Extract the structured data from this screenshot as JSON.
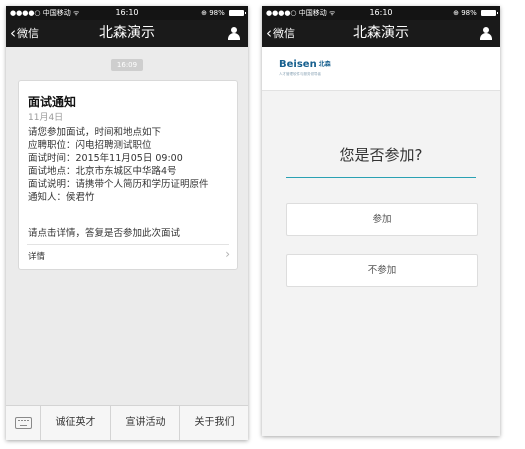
{
  "left_phone": {
    "status_bar": {
      "carrier": "●●●●○ 中国移动 ᯤ",
      "time": "16:10",
      "battery": "⊕ 98%"
    },
    "nav": {
      "back_label": "微信",
      "title": "北森演示"
    },
    "chat": {
      "timestamp": "16:09",
      "message": {
        "title": "面试通知",
        "date": "11月4日",
        "lines": [
          "请您参加面试，时间和地点如下",
          "应聘职位：闪电招聘测试职位",
          "面试时间：2015年11月05日 09:00",
          "面试地点：北京市东城区中华路4号",
          "面试说明：请携带个人简历和学历证明原件",
          "通知人：侯君竹"
        ],
        "prompt": "请点击详情，答复是否参加此次面试",
        "detail_label": "详情",
        "arrow": "›"
      }
    },
    "menu": {
      "items": [
        "诚征英才",
        "宣讲活动",
        "关于我们"
      ]
    }
  },
  "right_phone": {
    "status_bar": {
      "carrier": "●●●●○ 中国移动 ᯤ",
      "time": "16:10",
      "battery": "⊕ 98%"
    },
    "nav": {
      "back_label": "微信",
      "title": "北森演示"
    },
    "brand": {
      "name": "Beisen",
      "name_cn": "北森",
      "subtitle": "人才管理软件与服务领导者"
    },
    "page": {
      "question": "您是否参加?",
      "yes_label": "参加",
      "no_label": "不参加"
    }
  },
  "colors": {
    "nav_bg": "#1a1a1a",
    "accent_line": "#2aa1b3",
    "brand": "#17608f"
  }
}
